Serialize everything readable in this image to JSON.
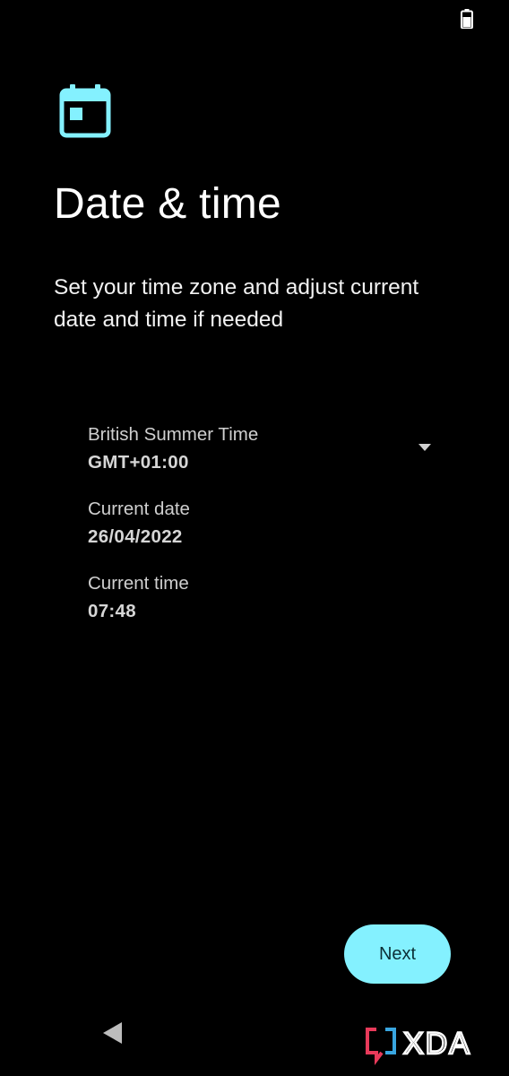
{
  "status_bar": {
    "battery_icon": "battery-icon"
  },
  "header": {
    "icon": "calendar-icon",
    "title": "Date & time",
    "subtitle": "Set your time zone and adjust current date and time if needed"
  },
  "settings": {
    "timezone": {
      "label": "British Summer Time",
      "value": "GMT+01:00",
      "icon": "dropdown-arrow-icon"
    },
    "date": {
      "label": "Current date",
      "value": "26/04/2022"
    },
    "time": {
      "label": "Current time",
      "value": "07:48"
    }
  },
  "footer": {
    "next_label": "Next"
  },
  "nav_bar": {
    "back_icon": "back-icon"
  },
  "watermark": {
    "text": "XDA"
  },
  "colors": {
    "background": "#000000",
    "accent": "#84f1ff",
    "button_text": "#0c2f36"
  }
}
